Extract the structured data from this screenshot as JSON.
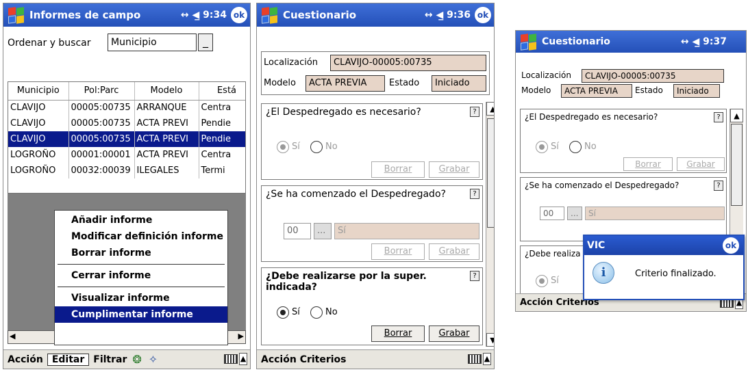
{
  "screen1": {
    "title": "Informes de campo",
    "status": "↔ ◀̲ 9:34",
    "ok": "ok",
    "sort_label": "Ordenar y buscar",
    "sort_value": "Municipio",
    "columns": [
      "Municipio",
      "Pol:Parc",
      "Modelo",
      "Está"
    ],
    "rows": [
      [
        "CLAVIJO",
        "00005:00735",
        "ARRANQUE",
        "Centra"
      ],
      [
        "CLAVIJO",
        "00005:00735",
        "ACTA PREVI",
        "Pendie"
      ],
      [
        "CLAVIJO",
        "00005:00735",
        "ACTA PREVI",
        "Pendie"
      ],
      [
        "LOGROÑO",
        "00001:00001",
        "ACTA PREVI",
        "Centra"
      ],
      [
        "LOGROÑO",
        "00032:00039",
        "ILEGALES",
        "Termi"
      ]
    ],
    "menu": [
      "Añadir informe",
      "Modificar definición informe",
      "Borrar informe",
      "Cerrar informe",
      "Visualizar informe",
      "Cumplimentar informe"
    ],
    "bottom": [
      "Acción",
      "Editar",
      "Filtrar"
    ]
  },
  "screen2": {
    "title": "Cuestionario",
    "status": "↔ ◀̲ 9:36",
    "ok": "ok",
    "loc_label": "Localización",
    "loc_value": "CLAVIJO-00005:00735",
    "model_label": "Modelo",
    "model_value": "ACTA PREVIA",
    "state_label": "Estado",
    "state_value": "Iniciado",
    "q1": "¿El Despedregado es necesario?",
    "q2": "¿Se ha comenzado el Despedregado?",
    "q3": "¿Debe realizarse por la super. indicada?",
    "yes": "Sí",
    "no": "No",
    "borrar": "Borrar",
    "grabar": "Grabar",
    "code": "00",
    "dots": "...",
    "answer": "Sí",
    "help": "?",
    "bottom": "Acción Criterios"
  },
  "screen3": {
    "title": "Cuestionario",
    "status": "↔ ◀̲ 9:37",
    "loc_label": "Localización",
    "loc_value": "CLAVIJO-00005:00735",
    "model_label": "Modelo",
    "model_value": "ACTA PREVIA",
    "state_label": "Estado",
    "state_value": "Iniciado",
    "q1": "¿El Despedregado es necesario?",
    "q2": "¿Se ha comenzado el Despedregado?",
    "q3_partial": "¿Debe realiza",
    "yes": "Sí",
    "no": "No",
    "borrar": "Borrar",
    "grabar": "Grabar",
    "code": "00",
    "dots": "...",
    "answer": "Sí",
    "help": "?",
    "bottom": "Acción Criterios",
    "dialog_title": "VIC",
    "dialog_ok": "ok",
    "dialog_msg": "Criterio finalizado."
  }
}
